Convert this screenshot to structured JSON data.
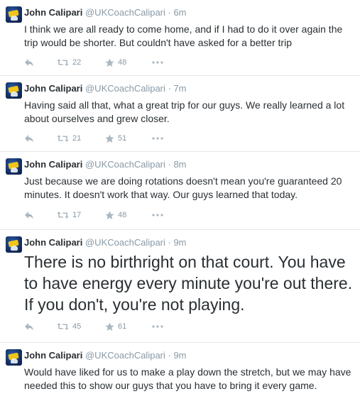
{
  "tweets": [
    {
      "name": "John Calipari",
      "handle": "@UKCoachCalipari",
      "time": "· 6m",
      "text": "I think we are all ready to come home, and if I had to do it over again the trip would be shorter. But couldn't have asked for a better trip",
      "retweets": "22",
      "favorites": "48"
    },
    {
      "name": "John Calipari",
      "handle": "@UKCoachCalipari",
      "time": "· 7m",
      "text": "Having said all that, what a great trip for our guys. We really learned a lot about ourselves and grew closer.",
      "retweets": "21",
      "favorites": "51"
    },
    {
      "name": "John Calipari",
      "handle": "@UKCoachCalipari",
      "time": "· 8m",
      "text": "Just because we are doing rotations doesn't mean you're guaranteed 20 minutes. It doesn't work that way. Our guys learned that today.",
      "retweets": "17",
      "favorites": "48"
    },
    {
      "name": "John Calipari",
      "handle": "@UKCoachCalipari",
      "time": "· 9m",
      "text": "There is no birthright on that court. You have to have energy every minute you're out there. If you don't, you're not playing.",
      "retweets": "45",
      "favorites": "61"
    },
    {
      "name": "John Calipari",
      "handle": "@UKCoachCalipari",
      "time": "· 9m",
      "text": "Would have liked for us to make a play down the stretch, but we may have needed this to show our guys that you have to bring it every game."
    }
  ],
  "icons": {
    "reply": "reply-icon",
    "retweet": "retweet-icon",
    "favorite": "star-icon",
    "more": "more-icon"
  },
  "colors": {
    "text": "#292f33",
    "muted": "#8899a6",
    "divider": "#e1e8ed"
  }
}
